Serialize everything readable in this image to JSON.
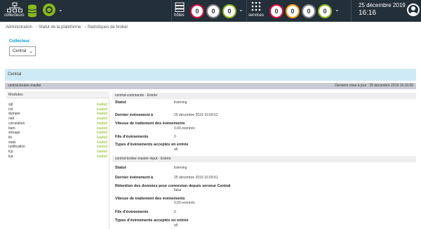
{
  "header": {
    "pollers_label": "collecteurs",
    "hosts_label": "hôtes",
    "hosts_counts": [
      "0",
      "0",
      "0"
    ],
    "services_label": "services",
    "services_counts": [
      "0",
      "0",
      "0",
      "0"
    ],
    "date": "25 décembre 2019",
    "time": "16:16",
    "colors": {
      "critical": "#e00b3d",
      "warning": "#ff9a13",
      "unknown": "#818285",
      "ok": "#88b917",
      "bar": "#232f39"
    }
  },
  "breadcrumb": [
    "Administration",
    "Statut de la plateforme",
    "Statistiques de broker"
  ],
  "collector": {
    "label": "Collecteur",
    "selected": "Central"
  },
  "central": {
    "title": "Central",
    "broker_name": "central-broker-master",
    "last_update": "Dernière mise à jour : 25 décembre 2019 16:16:09"
  },
  "modules": {
    "header": "Modules",
    "items": [
      {
        "name": "sql",
        "status": "loaded"
      },
      {
        "name": "rrd",
        "status": "loaded"
      },
      {
        "name": "dumper",
        "status": "loaded"
      },
      {
        "name": "neb",
        "status": "loaded"
      },
      {
        "name": "correlation",
        "status": "loaded"
      },
      {
        "name": "bam",
        "status": "loaded"
      },
      {
        "name": "storage",
        "status": "loaded"
      },
      {
        "name": "tls",
        "status": "loaded"
      },
      {
        "name": "stats",
        "status": "loaded"
      },
      {
        "name": "notification",
        "status": "loaded"
      },
      {
        "name": "tcp",
        "status": "loaded"
      },
      {
        "name": "lua",
        "status": "loaded"
      }
    ]
  },
  "sections": [
    {
      "title": "central-commands - Entrée",
      "rows": [
        {
          "label": "Statut",
          "value": "listening"
        },
        {
          "label": "Dernier évènement à",
          "value": "25 décembre 2019 16:09:51"
        },
        {
          "label": "Vitesse de traitement des évènements",
          "value": "0.00 events/s"
        },
        {
          "label": "File d'évènements",
          "value": "0"
        },
        {
          "label": "Types d'évènements acceptés en entrée",
          "value": "all"
        }
      ]
    },
    {
      "title": "central-broker-master-input - Entrée",
      "rows": [
        {
          "label": "Statut",
          "value": "listening"
        },
        {
          "label": "Dernier évènement à",
          "value": "25 décembre 2019 16:09:51"
        },
        {
          "label": "Rétention des données pour connexion depuis serveur Central",
          "value": "false"
        },
        {
          "label": "Vitesse de traitement des évènements",
          "value": "0.00 events/s"
        },
        {
          "label": "File d'évènements",
          "value": "0"
        },
        {
          "label": "Types d'évènements acceptés en entrée",
          "value": "all"
        }
      ]
    }
  ]
}
